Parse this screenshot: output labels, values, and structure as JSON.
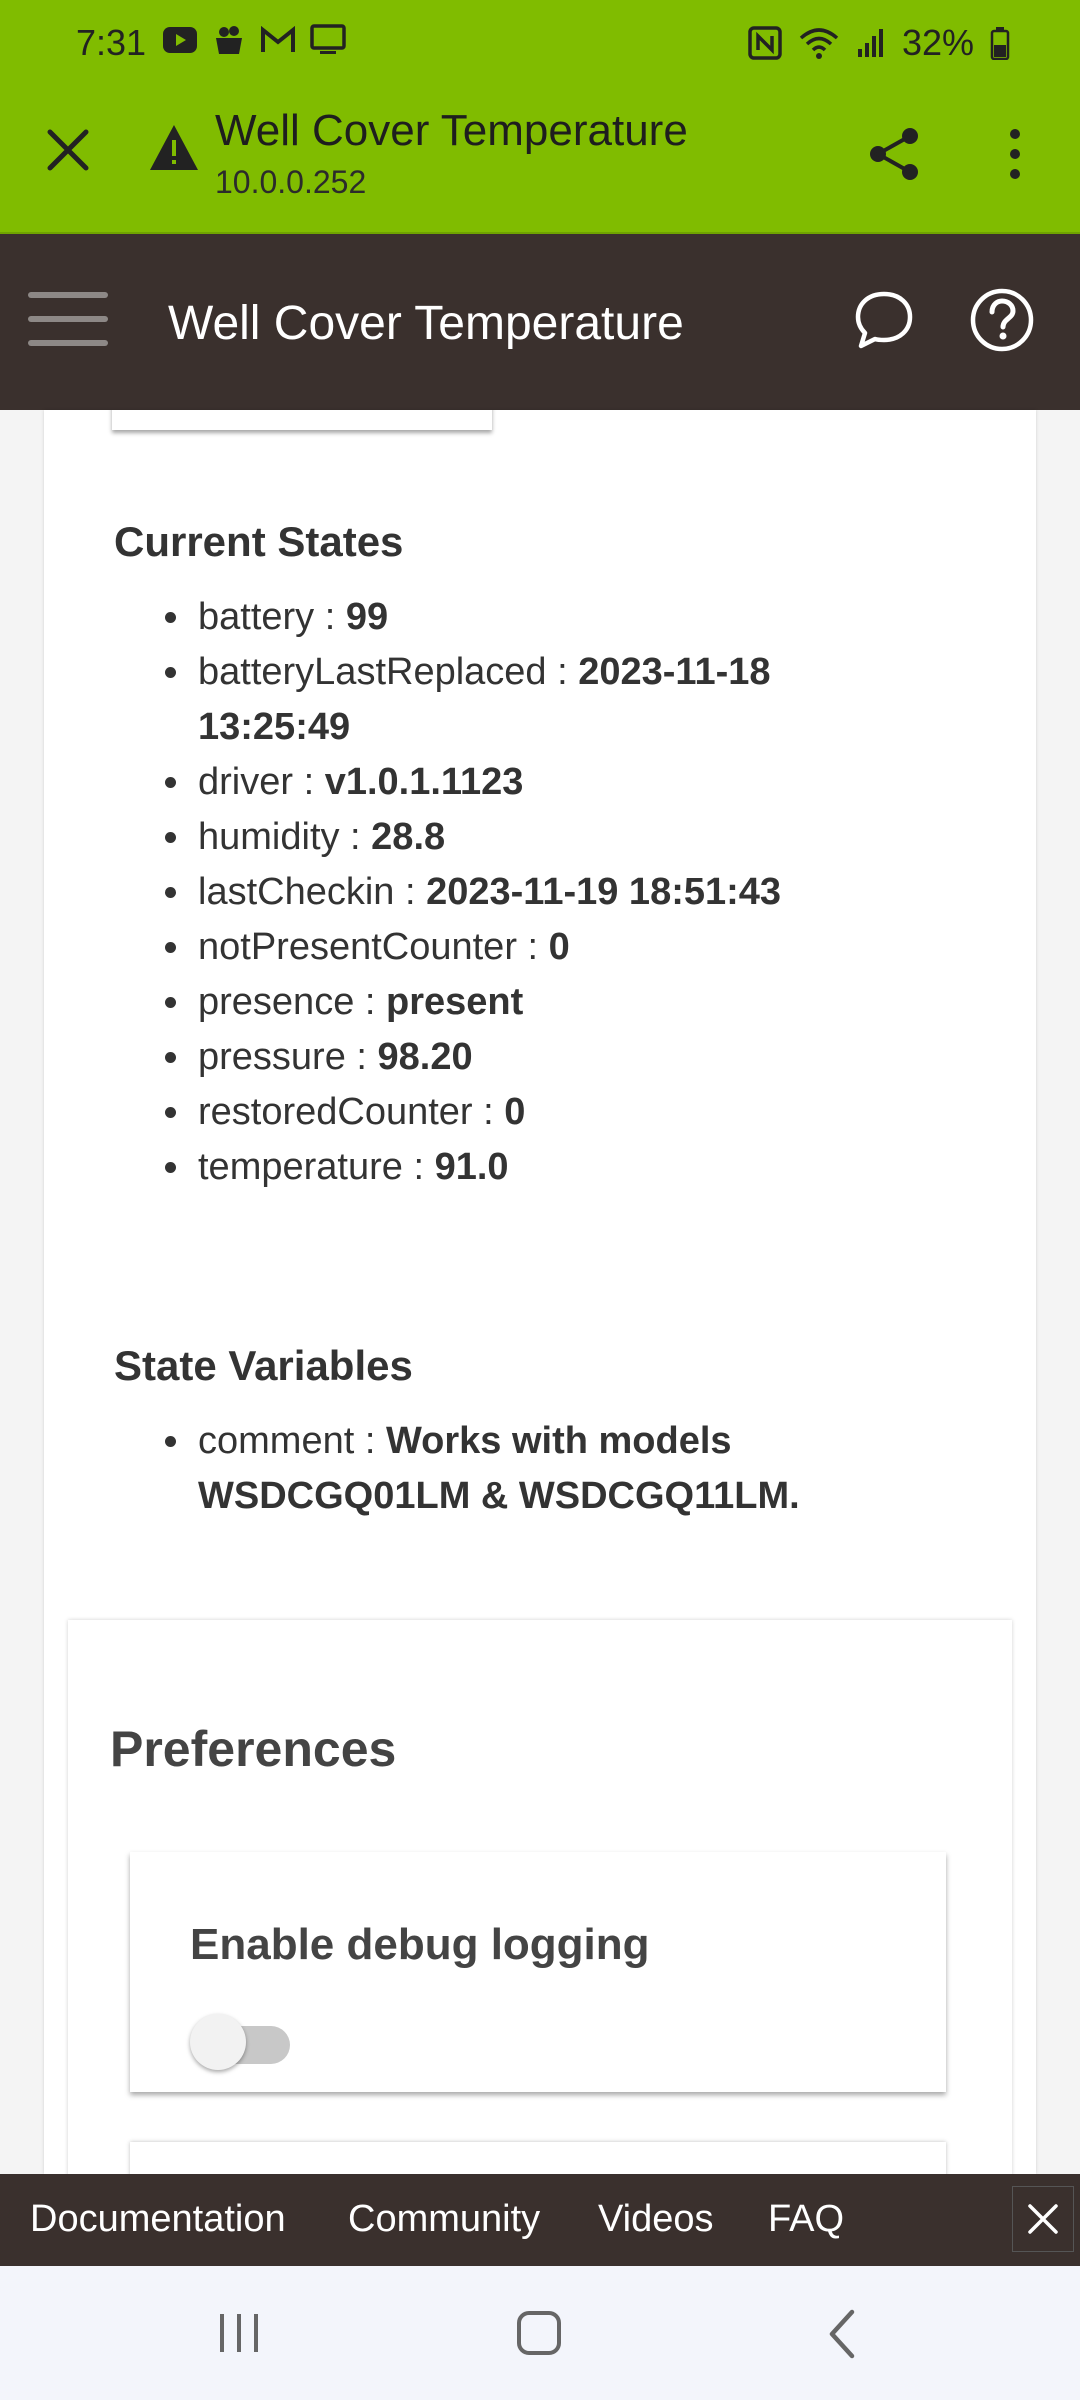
{
  "status_bar": {
    "time": "7:31",
    "battery_percent": "32%",
    "left_icons": [
      "youtube-icon",
      "cloud-pot-icon",
      "gmail-icon",
      "monitor-icon"
    ],
    "right_icons": [
      "nfc-icon",
      "wifi-icon",
      "signal-icon",
      "battery-icon"
    ]
  },
  "browser": {
    "title": "Well Cover Temperature",
    "url": "10.0.0.252"
  },
  "app_header": {
    "title": "Well Cover Temperature"
  },
  "current_states": {
    "heading": "Current States",
    "items": [
      {
        "key": "battery : ",
        "value": "99"
      },
      {
        "key": "batteryLastReplaced : ",
        "value": "2023-11-18 13:25:49"
      },
      {
        "key": "driver : ",
        "value": "v1.0.1.1123"
      },
      {
        "key": "humidity : ",
        "value": "28.8"
      },
      {
        "key": "lastCheckin : ",
        "value": "2023-11-19 18:51:43"
      },
      {
        "key": "notPresentCounter : ",
        "value": "0"
      },
      {
        "key": "presence : ",
        "value": "present"
      },
      {
        "key": "pressure : ",
        "value": "98.20"
      },
      {
        "key": "restoredCounter : ",
        "value": "0"
      },
      {
        "key": "temperature : ",
        "value": "91.0"
      }
    ]
  },
  "state_variables": {
    "heading": "State Variables",
    "items": [
      {
        "key": "comment : ",
        "value": "Works with models WSDCGQ01LM & WSDCGQ11LM."
      }
    ]
  },
  "preferences": {
    "heading": "Preferences",
    "debug_label": "Enable debug logging",
    "debug_enabled": false
  },
  "footer": {
    "links": [
      "Documentation",
      "Community",
      "Videos",
      "FAQ"
    ]
  },
  "colors": {
    "browser_bar": "#80bc00",
    "app_header": "#3a302d"
  }
}
